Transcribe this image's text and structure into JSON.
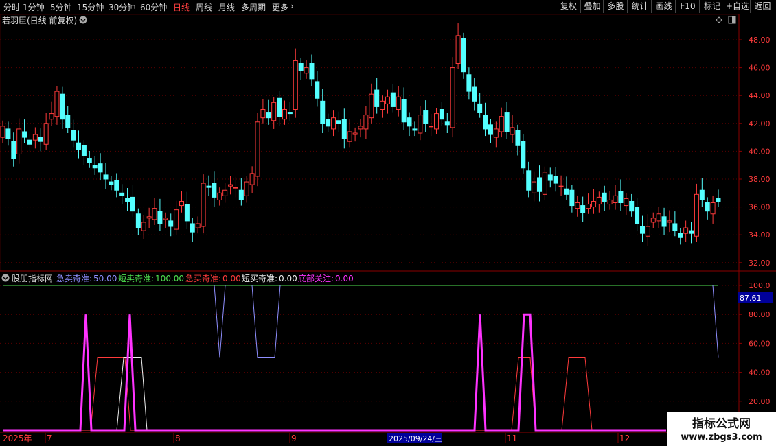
{
  "toolbar": {
    "periods": [
      {
        "label": "分时",
        "active": false
      },
      {
        "label": "1分钟",
        "active": false
      },
      {
        "label": "5分钟",
        "active": false
      },
      {
        "label": "15分钟",
        "active": false
      },
      {
        "label": "30分钟",
        "active": false
      },
      {
        "label": "60分钟",
        "active": false
      },
      {
        "label": "日线",
        "active": true
      },
      {
        "label": "周线",
        "active": false
      },
      {
        "label": "月线",
        "active": false
      },
      {
        "label": "多周期",
        "active": false
      },
      {
        "label": "更多",
        "active": false
      }
    ],
    "right_buttons": [
      "复权",
      "叠加",
      "多股",
      "统计",
      "画线",
      "F10",
      "标记",
      "+自选",
      "返回"
    ]
  },
  "main_chart": {
    "title": "若羽臣(日线 前复权)",
    "price_ticks": [
      "48.00",
      "46.00",
      "44.00",
      "42.00",
      "40.00",
      "38.00",
      "36.00",
      "34.00",
      "32.00"
    ]
  },
  "indicator": {
    "name": "股朋指标网",
    "items": [
      {
        "label": "急卖奇准:",
        "value": "50.00",
        "color": "#8f8fff"
      },
      {
        "label": "短卖奇准:",
        "value": "100.00",
        "color": "#4fe04f"
      },
      {
        "label": "急买奇准:",
        "value": "0.00",
        "color": "#ff3b3b"
      },
      {
        "label": "短买奇准:",
        "value": "0.00",
        "color": "#f0f0f0"
      },
      {
        "label": "底部关注:",
        "value": "0.00",
        "color": "#ff33ff"
      }
    ],
    "ticks": [
      "100.0",
      "80.00",
      "60.00",
      "40.00",
      "20.00"
    ],
    "current_label": "87.61"
  },
  "time_axis": {
    "labels": [
      "2025年",
      "7",
      "8",
      "9",
      "2025/09/24/三",
      "11",
      "12"
    ]
  },
  "watermark": {
    "title": "指标公式网",
    "url": "www.zbgs3.com"
  },
  "colors": {
    "up": "#ff3b3b",
    "down": "#54ffff",
    "grid": "#5a0000",
    "axis": "#8b0000"
  }
}
